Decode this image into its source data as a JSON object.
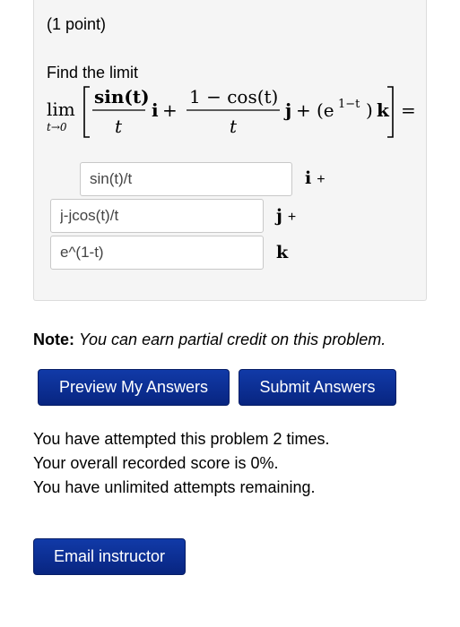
{
  "problem": {
    "points_label": "(1 point)",
    "instruction": "Find the limit",
    "math": {
      "lim": "lim",
      "lim_sub": "t→0",
      "frac1_num": "sin(t)",
      "frac1_den": "t",
      "plus": "+",
      "i": "i",
      "frac2_num": "1 − cos(t)",
      "frac2_den": "t",
      "j": "j",
      "exp_base": "(e",
      "exp_power": "1−t",
      "exp_close": ")",
      "k": "k",
      "equals": "="
    },
    "answers": [
      {
        "value": "sin(t)/t",
        "unit_symbol": "i",
        "suffix": "+"
      },
      {
        "value": "j-jcos(t)/t",
        "unit_symbol": "j",
        "suffix": "+"
      },
      {
        "value": "e^(1-t)",
        "unit_symbol": "k",
        "suffix": ""
      }
    ]
  },
  "note": {
    "label": "Note:",
    "text": "You can earn partial credit on this problem."
  },
  "buttons": {
    "preview": "Preview My Answers",
    "submit": "Submit Answers",
    "email": "Email instructor"
  },
  "status": {
    "attempts": "You have attempted this problem 2 times.",
    "score": "Your overall recorded score is 0%.",
    "remaining": "You have unlimited attempts remaining."
  },
  "colors": {
    "button_bg": "#0a2a8a",
    "panel_bg": "#f5f5f5"
  }
}
